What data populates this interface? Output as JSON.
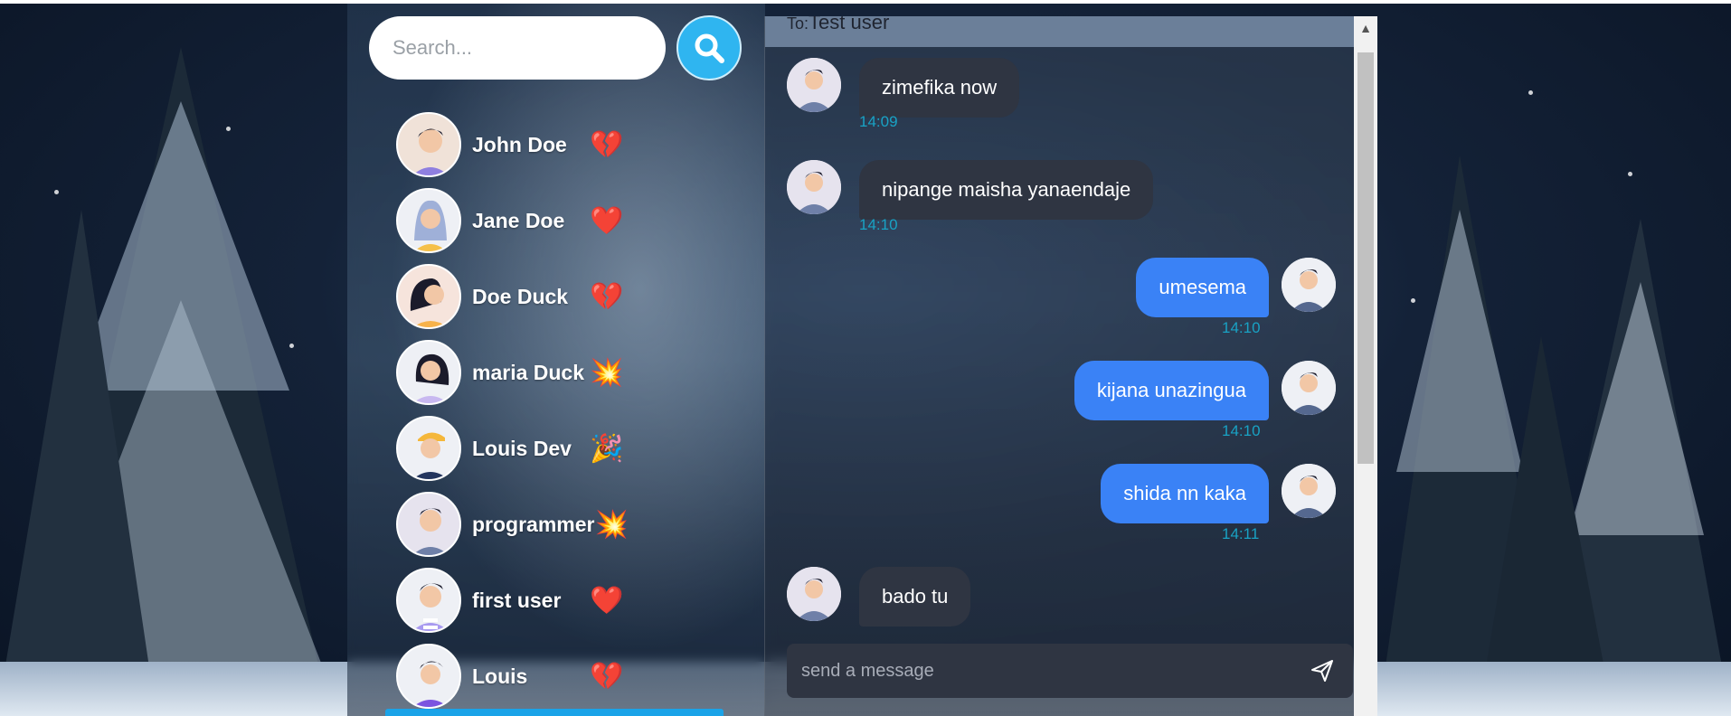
{
  "search": {
    "placeholder": "Search..."
  },
  "contacts": [
    {
      "name": "John Doe",
      "emoji": "💔"
    },
    {
      "name": "Jane Doe",
      "emoji": "❤️"
    },
    {
      "name": "Doe Duck",
      "emoji": "💔"
    },
    {
      "name": "maria Duck",
      "emoji": "💥"
    },
    {
      "name": "Louis Dev",
      "emoji": "🎉"
    },
    {
      "name": "programmer",
      "emoji": "💥"
    },
    {
      "name": "first user",
      "emoji": "❤️"
    },
    {
      "name": "Louis",
      "emoji": "💔"
    }
  ],
  "chat": {
    "to_label": "To:",
    "recipient": "Test user",
    "messages": [
      {
        "text": "zimefika now",
        "time": "14:09",
        "direction": "incoming"
      },
      {
        "text": "nipange maisha yanaendaje",
        "time": "14:10",
        "direction": "incoming"
      },
      {
        "text": "umesema",
        "time": "14:10",
        "direction": "outgoing"
      },
      {
        "text": "kijana unazingua",
        "time": "14:10",
        "direction": "outgoing"
      },
      {
        "text": "shida nn kaka",
        "time": "14:11",
        "direction": "outgoing"
      },
      {
        "text": "bado tu",
        "time": "",
        "direction": "incoming"
      }
    ],
    "composer_placeholder": "send a message"
  },
  "icons": {
    "search": "search-icon",
    "send": "send-icon",
    "scroll_up": "chevron-up-icon"
  },
  "colors": {
    "search_button": "#2fb5f0",
    "outgoing_bubble": "#3a82f6",
    "incoming_bubble": "#2f3542",
    "timestamp": "#19a2c4",
    "selected_contact": "#1aa3e8"
  }
}
